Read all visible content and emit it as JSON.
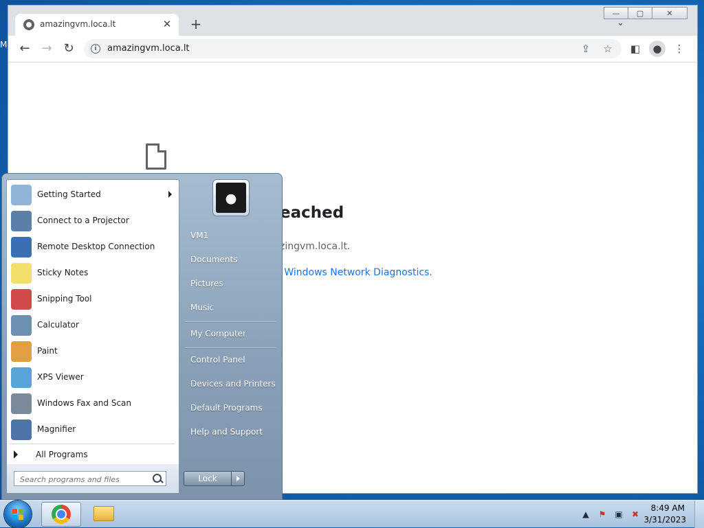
{
  "desktop": {
    "label": "M"
  },
  "browser": {
    "tab": {
      "title": "amazingvm.loca.lt",
      "close": "✕"
    },
    "new_tab": "+",
    "tabs_menu": "⌄",
    "window_buttons": {
      "minimize": "—",
      "maximize": "▢",
      "close": "✕"
    },
    "nav": {
      "back": "←",
      "forward": "→",
      "reload": "↻"
    },
    "address": {
      "url": "amazingvm.loca.lt",
      "info": "i"
    },
    "toolbar_icons": {
      "share": "⇪",
      "bookmark": "☆",
      "side_panel": "◧",
      "profile": "●",
      "menu": "⋮"
    },
    "error": {
      "heading": "eached",
      "host": "zingvm.loca.lt.",
      "link": "g Windows Network Diagnostics."
    }
  },
  "start_menu": {
    "programs": [
      {
        "label": "Getting Started",
        "icon": "getting-started-icon",
        "color": "#8fb4d8"
      },
      {
        "label": "Connect to a Projector",
        "icon": "projector-icon",
        "color": "#5a7fa8"
      },
      {
        "label": "Remote Desktop Connection",
        "icon": "remote-desktop-icon",
        "color": "#3b6fb4"
      },
      {
        "label": "Sticky Notes",
        "icon": "sticky-notes-icon",
        "color": "#f3e06a"
      },
      {
        "label": "Snipping Tool",
        "icon": "snipping-tool-icon",
        "color": "#d24b4b"
      },
      {
        "label": "Calculator",
        "icon": "calculator-icon",
        "color": "#6d8fb0"
      },
      {
        "label": "Paint",
        "icon": "paint-icon",
        "color": "#e0a040"
      },
      {
        "label": "XPS Viewer",
        "icon": "xps-viewer-icon",
        "color": "#58a4d8"
      },
      {
        "label": "Windows Fax and Scan",
        "icon": "fax-scan-icon",
        "color": "#7a8a9a"
      },
      {
        "label": "Magnifier",
        "icon": "magnifier-icon",
        "color": "#4d74a6"
      }
    ],
    "all_programs": "All Programs",
    "search_placeholder": "Search programs and files",
    "right_items": [
      "VM1",
      "Documents",
      "Pictures",
      "Music",
      "My Computer",
      "Control Panel",
      "Devices and Printers",
      "Default Programs",
      "Help and Support"
    ],
    "lock": "Lock"
  },
  "taskbar": {
    "tray": {
      "show_hidden": "▲",
      "flag": "⚑",
      "network": "▣",
      "volume": "✖"
    },
    "clock": {
      "time": "8:49 AM",
      "date": "3/31/2023"
    }
  }
}
